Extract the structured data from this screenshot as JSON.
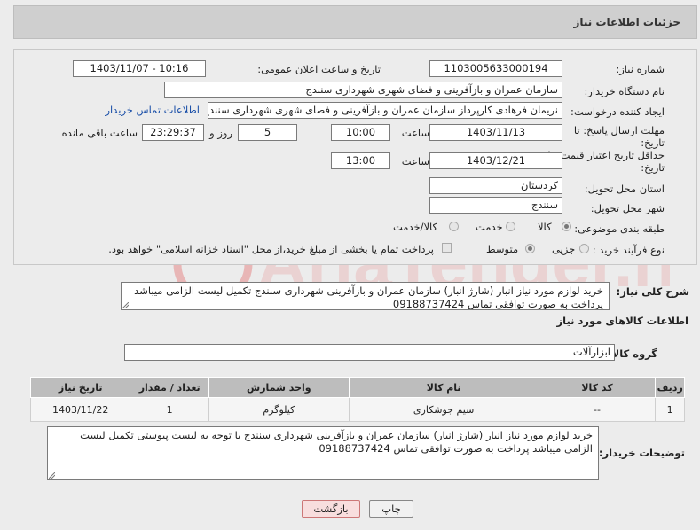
{
  "header": {
    "title": "جزئیات اطلاعات نیاز"
  },
  "form": {
    "need_number_label": "شماره نیاز:",
    "need_number": "1103005633000194",
    "announce_label": "تاریخ و ساعت اعلان عمومی:",
    "announce_value": "1403/11/07 - 10:16",
    "buyer_org_label": "نام دستگاه خریدار:",
    "buyer_org": "سازمان عمران و بازآفرینی و فضای شهری شهرداری سنندج",
    "requester_label": "ایجاد کننده درخواست:",
    "requester": "نریمان فرهادی کارپرداز سازمان عمران و بازآفرینی و فضای شهری شهرداری سنندج",
    "buyer_contact_link": "اطلاعات تماس خریدار",
    "deadline_label_1": "مهلت ارسال پاسخ: تا",
    "deadline_label_2": "تاریخ:",
    "deadline_date": "1403/11/13",
    "time_label": "ساعت",
    "deadline_time": "10:00",
    "days_value": "5",
    "days_label": "روز و",
    "remaining_time": "23:29:37",
    "remaining_label": "ساعت باقی مانده",
    "min_validity_label_1": "حداقل تاریخ اعتبار قیمت: تا",
    "min_validity_label_2": "تاریخ:",
    "validity_date": "1403/12/21",
    "validity_time_label": "ساعت",
    "validity_time": "13:00",
    "province_label": "استان محل تحویل:",
    "province": "کردستان",
    "city_label": "شهر محل تحویل:",
    "city": "سنندج",
    "category_label": "طبقه بندی موضوعی:",
    "category_options": [
      "کالا",
      "خدمت",
      "کالا/خدمت"
    ],
    "category_selected": "کالا",
    "process_label": "نوع فرآیند خرید :",
    "process_options": [
      "جزیی",
      "متوسط"
    ],
    "process_selected": "متوسط",
    "payment_note": "پرداخت تمام یا بخشی از مبلغ خرید،از محل \"اسناد خزانه اسلامی\" خواهد بود."
  },
  "summary": {
    "label": "شرح کلی نیاز:",
    "text": "خرید لوازم مورد نیاز انبار (شارژ انبار) سازمان عمران و بازآفرینی شهرداری سنندج تکمیل لیست الزامی میباشد پرداخت به صورت توافقی تماس 09188737424"
  },
  "goods": {
    "section_title": "اطلاعات کالاهای مورد نیاز",
    "group_label": "گروه کالا:",
    "group_value": "ابزارآلات",
    "columns": [
      "ردیف",
      "کد کالا",
      "نام کالا",
      "واحد شمارش",
      "تعداد / مقدار",
      "تاریخ نیاز"
    ],
    "rows": [
      {
        "row": "1",
        "code": "--",
        "name": "سیم جوشکاری",
        "unit": "کیلوگرم",
        "qty": "1",
        "date": "1403/11/22"
      }
    ]
  },
  "buyer_notes": {
    "label": "توضیحات خریدار:",
    "text": "خرید لوازم مورد نیاز انبار (شارژ انبار) سازمان عمران و بازآفرینی شهرداری سنندج با توجه به لیست پیوستی تکمیل لیست الزامی میباشد پرداخت به صورت توافقی تماس 09188737424"
  },
  "buttons": {
    "print": "چاپ",
    "back": "بازگشت"
  },
  "watermark": {
    "text": "AriaTender.neT"
  },
  "colors": {
    "header_bg": "#cfcfcf",
    "page_bg": "#ececec",
    "table_header": "#bdbdbd",
    "link": "#1a4fa8",
    "back_button": "#f8dede",
    "watermark": "#e25555"
  }
}
